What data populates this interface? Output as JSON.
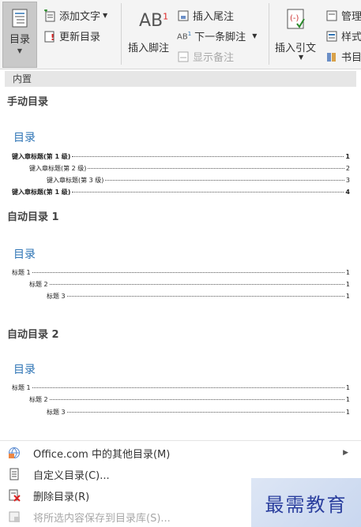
{
  "ribbon": {
    "toc_label": "目录",
    "add_text": "添加文字",
    "update_toc": "更新目录",
    "insert_footnote": "插入脚注",
    "insert_endnote": "插入尾注",
    "next_footnote": "下一条脚注",
    "show_notes": "显示备注",
    "insert_citation": "插入引文",
    "manage": "管理",
    "style": "样式",
    "bibliography": "书目",
    "ab_main": "AB",
    "ab_sup": "1"
  },
  "panel": {
    "builtin_header": "内置",
    "manual": {
      "title": "手动目录",
      "heading": "目录",
      "lines": [
        {
          "text": "键入章标题(第 1 级)",
          "page": "1"
        },
        {
          "text": "键入章标题(第 2 级)",
          "page": "2"
        },
        {
          "text": "键入章标题(第 3 级)",
          "page": "3"
        },
        {
          "text": "键入章标题(第 1 级)",
          "page": "4"
        }
      ]
    },
    "auto1": {
      "title": "自动目录 1",
      "heading": "目录",
      "lines": [
        {
          "text": "标题 1",
          "page": "1"
        },
        {
          "text": "标题 2",
          "page": "1"
        },
        {
          "text": "标题 3",
          "page": "1"
        }
      ]
    },
    "auto2": {
      "title": "自动目录 2",
      "heading": "目录",
      "lines": [
        {
          "text": "标题 1",
          "page": "1"
        },
        {
          "text": "标题 2",
          "page": "1"
        },
        {
          "text": "标题 3",
          "page": "1"
        }
      ]
    },
    "menu": {
      "office": "Office.com 中的其他目录(M)",
      "custom": "自定义目录(C)...",
      "delete": "删除目录(R)",
      "save": "将所选内容保存到目录库(S)..."
    }
  },
  "watermark": "最需教育"
}
